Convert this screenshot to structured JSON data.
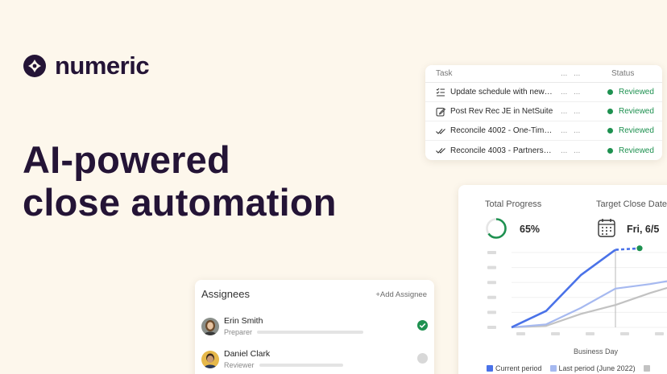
{
  "brand": {
    "name": "numeric"
  },
  "headline": {
    "line1": "AI-powered",
    "line2": "close automation"
  },
  "tasks": {
    "columns": {
      "task": "Task",
      "dots1": "...",
      "dots2": "...",
      "status": "Status"
    },
    "rows": [
      {
        "icon": "checklist-icon",
        "name": "Update schedule with new an...",
        "dots1": "...",
        "dots2": "...",
        "status": "Reviewed"
      },
      {
        "icon": "edit-note-icon",
        "name": "Post Rev Rec JE in NetSuite",
        "dots1": "...",
        "dots2": "...",
        "status": "Reviewed"
      },
      {
        "icon": "double-check-icon",
        "name": "Reconcile 4002 - One-Time...",
        "dots1": "...",
        "dots2": "...",
        "status": "Reviewed"
      },
      {
        "icon": "double-check-icon",
        "name": "Reconcile 4003 - Partnership...",
        "dots1": "...",
        "dots2": "...",
        "status": "Reviewed"
      }
    ],
    "status_color": "#1e9150"
  },
  "assignees": {
    "title": "Assignees",
    "add_label": "+Add Assignee",
    "people": [
      {
        "name": "Erin Smith",
        "role": "Preparer",
        "done": true
      },
      {
        "name": "Daniel Clark",
        "role": "Reviewer",
        "done": false
      }
    ]
  },
  "progress": {
    "total_label": "Total Progress",
    "total_value": "65%",
    "total_fraction": 0.65,
    "target_label": "Target Close Date",
    "target_value": "Fri, 6/5"
  },
  "chart_data": {
    "type": "line",
    "xlabel": "Business Day",
    "ylabel": "",
    "series": [
      {
        "name": "Current period",
        "color": "#4a72e8",
        "values": [
          0,
          11,
          35,
          52,
          53
        ]
      },
      {
        "name": "Last period (June 2022)",
        "color": "#a6b9f0",
        "values": [
          0,
          2,
          13,
          26,
          29,
          33
        ]
      },
      {
        "name": "",
        "color": "#c2c2c2",
        "values": [
          0,
          1,
          9,
          15,
          23,
          30
        ]
      }
    ],
    "ylim": [
      0,
      55
    ],
    "grid": true
  },
  "colors": {
    "background": "#fdf7ec",
    "brand_dark": "#241436",
    "accent_blue": "#4a72e8",
    "success": "#1e9150"
  }
}
